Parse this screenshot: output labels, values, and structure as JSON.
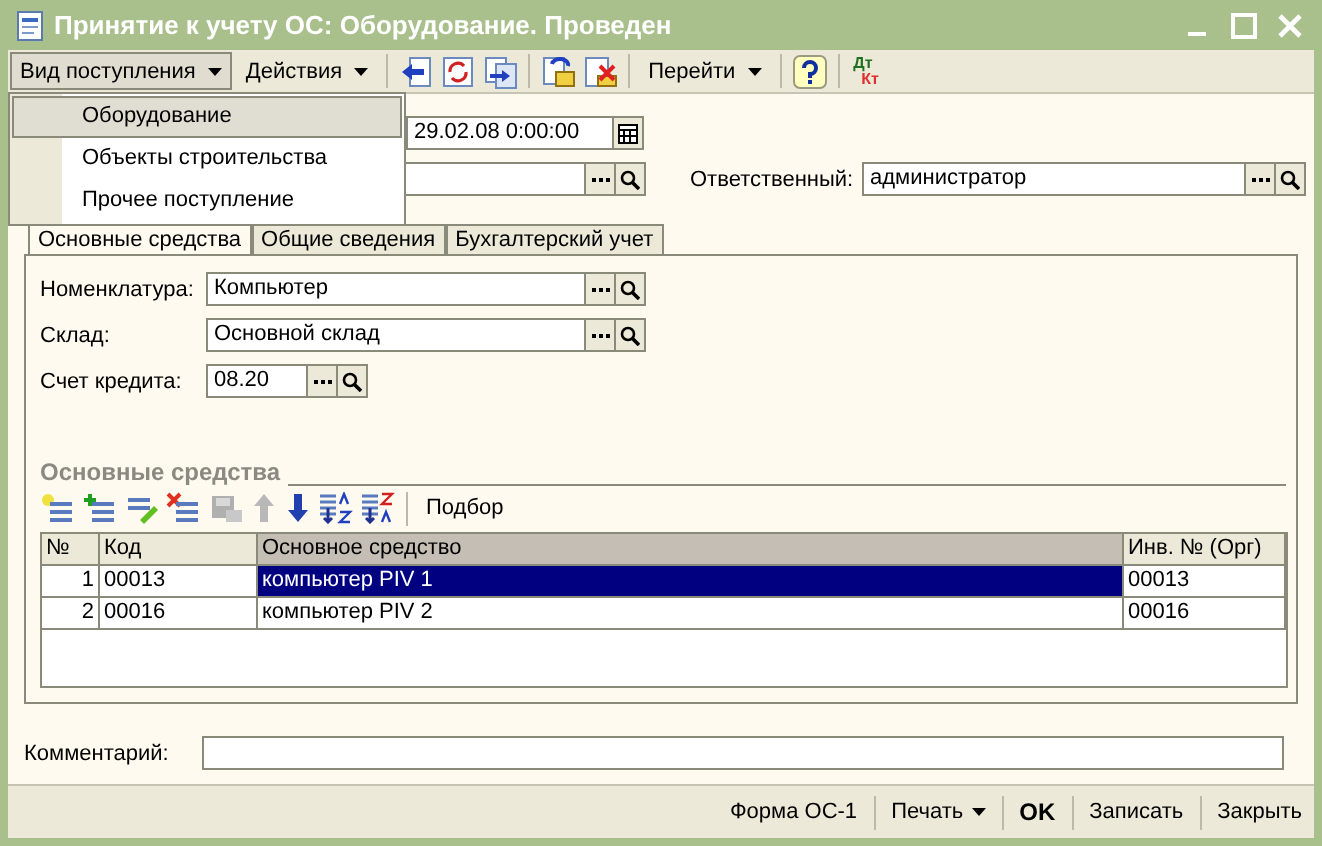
{
  "window": {
    "title": "Принятие к учету ОС: Оборудование. Проведен"
  },
  "toolbar": {
    "menus": [
      {
        "label": "Вид поступления",
        "open": true
      },
      {
        "label": "Действия",
        "open": false
      }
    ],
    "goto": "Перейти",
    "dt": "Дт",
    "kt": "Кт"
  },
  "dropdown": {
    "items": [
      {
        "label": "Оборудование",
        "selected": true
      },
      {
        "label": "Объекты строительства",
        "selected": false
      },
      {
        "label": "Прочее поступление",
        "selected": false
      }
    ]
  },
  "header": {
    "date": "29.02.08  0:00:00",
    "responsible_label": "Ответственный:",
    "responsible": "администратор"
  },
  "tabs": [
    {
      "label": "Основные средства",
      "selected": true
    },
    {
      "label": "Общие сведения",
      "selected": false
    },
    {
      "label": "Бухгалтерский учет",
      "selected": false
    }
  ],
  "fields": [
    {
      "label": "Номенклатура:",
      "value": "Компьютер",
      "kind": "reference"
    },
    {
      "label": "Склад:",
      "value": "Основной склад",
      "kind": "reference"
    },
    {
      "label": "Счет кредита:",
      "value": "08.20",
      "kind": "account"
    }
  ],
  "section_title": "Основные средства",
  "table_toolbar": {
    "pick": "Подбор"
  },
  "table": {
    "columns": [
      {
        "label": "№",
        "current": false
      },
      {
        "label": "Код",
        "current": false
      },
      {
        "label": "Основное средство",
        "current": true
      },
      {
        "label": "Инв. № (Орг)",
        "current": false
      }
    ],
    "rows": [
      {
        "cells": [
          "1",
          "00013",
          "компьютер PIV 1",
          "00013"
        ],
        "selected": true
      },
      {
        "cells": [
          "2",
          "00016",
          "компьютер PIV 2",
          "00016"
        ],
        "selected": false
      }
    ]
  },
  "comment": {
    "label": "Комментарий:"
  },
  "footer": {
    "buttons": [
      {
        "label": "Форма ОС-1",
        "kind": "plain"
      },
      {
        "label": "Печать",
        "kind": "menu"
      },
      {
        "label": "OK",
        "kind": "default"
      },
      {
        "label": "Записать",
        "kind": "plain"
      },
      {
        "label": "Закрыть",
        "kind": "plain"
      }
    ]
  }
}
